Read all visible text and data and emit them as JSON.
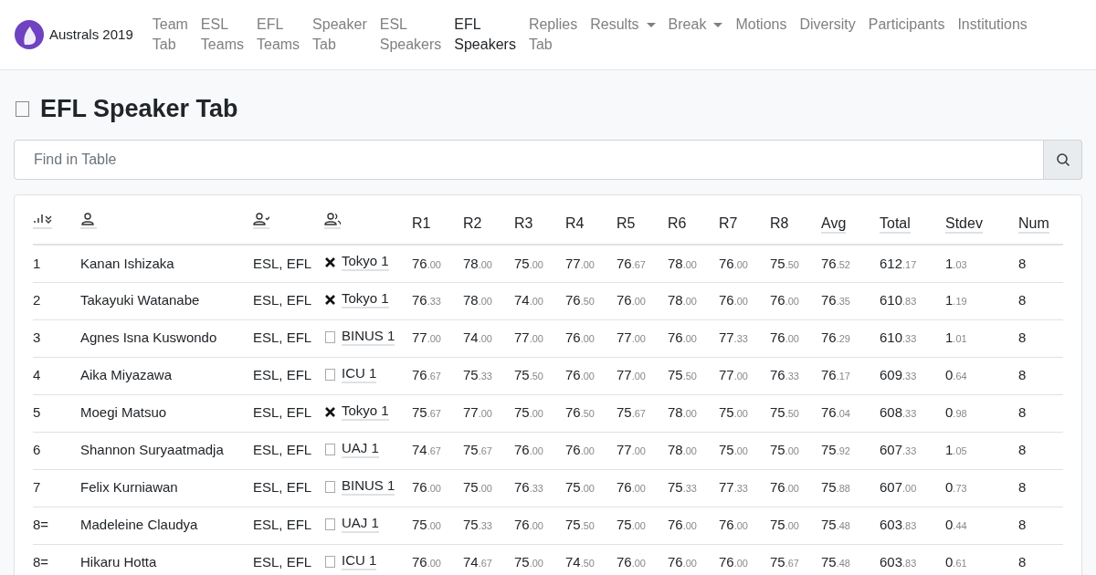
{
  "brand": {
    "name": "Australs 2019"
  },
  "nav": [
    {
      "label": "Team Tab",
      "selected": false,
      "dropdown": false
    },
    {
      "label": "ESL Teams",
      "selected": false,
      "dropdown": false
    },
    {
      "label": "EFL Teams",
      "selected": false,
      "dropdown": false
    },
    {
      "label": "Speaker Tab",
      "selected": false,
      "dropdown": false
    },
    {
      "label": "ESL Speakers",
      "selected": false,
      "dropdown": false
    },
    {
      "label": "EFL Speakers",
      "selected": true,
      "dropdown": false
    },
    {
      "label": "Replies Tab",
      "selected": false,
      "dropdown": false
    },
    {
      "label": "Results",
      "selected": false,
      "dropdown": true
    },
    {
      "label": "Break",
      "selected": false,
      "dropdown": true
    },
    {
      "label": "Motions",
      "selected": false,
      "dropdown": false
    },
    {
      "label": "Diversity",
      "selected": false,
      "dropdown": false
    },
    {
      "label": "Participants",
      "selected": false,
      "dropdown": false
    },
    {
      "label": "Institutions",
      "selected": false,
      "dropdown": false
    }
  ],
  "page_title": "EFL Speaker Tab",
  "search": {
    "placeholder": "Find in Table"
  },
  "table": {
    "columns": [
      {
        "kind": "rank-icon",
        "underlined": true
      },
      {
        "kind": "person-icon",
        "underlined": true
      },
      {
        "kind": "person-check-icon",
        "underlined": true
      },
      {
        "kind": "people-icon",
        "underlined": true
      },
      {
        "kind": "text",
        "label": "R1",
        "underlined": false
      },
      {
        "kind": "text",
        "label": "R2",
        "underlined": false
      },
      {
        "kind": "text",
        "label": "R3",
        "underlined": false
      },
      {
        "kind": "text",
        "label": "R4",
        "underlined": false
      },
      {
        "kind": "text",
        "label": "R5",
        "underlined": false
      },
      {
        "kind": "text",
        "label": "R6",
        "underlined": false
      },
      {
        "kind": "text",
        "label": "R7",
        "underlined": false
      },
      {
        "kind": "text",
        "label": "R8",
        "underlined": false
      },
      {
        "kind": "text",
        "label": "Avg",
        "underlined": true
      },
      {
        "kind": "text",
        "label": "Total",
        "underlined": true
      },
      {
        "kind": "text",
        "label": "Stdev",
        "underlined": true
      },
      {
        "kind": "text",
        "label": "Num",
        "underlined": true
      }
    ],
    "rows": [
      {
        "rank": "1",
        "name": "Kanan Ishizaka",
        "categories": "ESL, EFL",
        "team_cross": true,
        "team": "Tokyo 1",
        "rounds": [
          "76.00",
          "78.00",
          "75.00",
          "77.00",
          "76.67",
          "78.00",
          "76.00",
          "75.50"
        ],
        "avg": "76.52",
        "total": "612.17",
        "stdev": "1.03",
        "num": "8"
      },
      {
        "rank": "2",
        "name": "Takayuki Watanabe",
        "categories": "ESL, EFL",
        "team_cross": true,
        "team": "Tokyo 1",
        "rounds": [
          "76.33",
          "78.00",
          "74.00",
          "76.50",
          "76.00",
          "78.00",
          "76.00",
          "76.00"
        ],
        "avg": "76.35",
        "total": "610.83",
        "stdev": "1.19",
        "num": "8"
      },
      {
        "rank": "3",
        "name": "Agnes Isna Kuswondo",
        "categories": "ESL, EFL",
        "team_cross": false,
        "team": "BINUS 1",
        "rounds": [
          "77.00",
          "74.00",
          "77.00",
          "76.00",
          "77.00",
          "76.00",
          "77.33",
          "76.00"
        ],
        "avg": "76.29",
        "total": "610.33",
        "stdev": "1.01",
        "num": "8"
      },
      {
        "rank": "4",
        "name": "Aika Miyazawa",
        "categories": "ESL, EFL",
        "team_cross": false,
        "team": "ICU 1",
        "rounds": [
          "76.67",
          "75.33",
          "75.50",
          "76.00",
          "77.00",
          "75.50",
          "77.00",
          "76.33"
        ],
        "avg": "76.17",
        "total": "609.33",
        "stdev": "0.64",
        "num": "8"
      },
      {
        "rank": "5",
        "name": "Moegi Matsuo",
        "categories": "ESL, EFL",
        "team_cross": true,
        "team": "Tokyo 1",
        "rounds": [
          "75.67",
          "77.00",
          "75.00",
          "76.50",
          "75.67",
          "78.00",
          "75.00",
          "75.50"
        ],
        "avg": "76.04",
        "total": "608.33",
        "stdev": "0.98",
        "num": "8"
      },
      {
        "rank": "6",
        "name": "Shannon Suryaatmadja",
        "categories": "ESL, EFL",
        "team_cross": false,
        "team": "UAJ 1",
        "rounds": [
          "74.67",
          "75.67",
          "76.00",
          "76.00",
          "77.00",
          "78.00",
          "75.00",
          "75.00"
        ],
        "avg": "75.92",
        "total": "607.33",
        "stdev": "1.05",
        "num": "8"
      },
      {
        "rank": "7",
        "name": "Felix Kurniawan",
        "categories": "ESL, EFL",
        "team_cross": false,
        "team": "BINUS 1",
        "rounds": [
          "76.00",
          "75.00",
          "76.33",
          "75.00",
          "76.00",
          "75.33",
          "77.33",
          "76.00"
        ],
        "avg": "75.88",
        "total": "607.00",
        "stdev": "0.73",
        "num": "8"
      },
      {
        "rank": "8=",
        "name": "Madeleine Claudya",
        "categories": "ESL, EFL",
        "team_cross": false,
        "team": "UAJ 1",
        "rounds": [
          "75.00",
          "75.33",
          "76.00",
          "75.50",
          "75.00",
          "76.00",
          "76.00",
          "75.00"
        ],
        "avg": "75.48",
        "total": "603.83",
        "stdev": "0.44",
        "num": "8"
      },
      {
        "rank": "8=",
        "name": "Hikaru Hotta",
        "categories": "ESL, EFL",
        "team_cross": false,
        "team": "ICU 1",
        "rounds": [
          "76.00",
          "74.67",
          "75.00",
          "74.50",
          "76.00",
          "76.00",
          "76.00",
          "75.67"
        ],
        "avg": "75.48",
        "total": "603.83",
        "stdev": "0.61",
        "num": "8"
      }
    ]
  }
}
